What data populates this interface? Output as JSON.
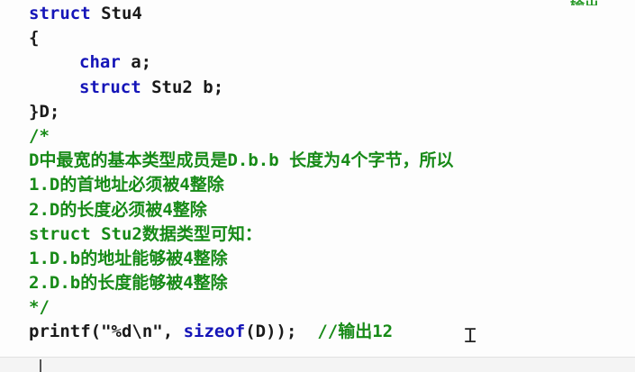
{
  "colors": {
    "keyword": "#1515b8",
    "comment": "#178a17",
    "text": "#1a1a1a",
    "background": "#fdfdfd"
  },
  "code": {
    "top_fragment": "输出",
    "line1_kw": "struct",
    "line1_rest": " Stu4",
    "line2": "{",
    "line3_kw": "char",
    "line3_rest": " a;",
    "line4_kw": "struct",
    "line4_rest": " Stu2 b;",
    "line5": "}D;",
    "line6": "/*",
    "line7": "D中最宽的基本类型成员是D.b.b 长度为4个字节，所以",
    "line8": "1.D的首地址必须被4整除",
    "line9": "2.D的长度必须被4整除",
    "line10": "struct Stu2数据类型可知：",
    "line11": "1.D.b的地址能够被4整除",
    "line12": "2.D.b的长度能够被4整除",
    "line13": "*/",
    "line14_start": "printf(\"%d\\n\", ",
    "line14_kw": "sizeof",
    "line14_end": "(D));  ",
    "line14_comment": "//输出12"
  },
  "icons": {
    "cursor": "text-cursor-icon"
  }
}
